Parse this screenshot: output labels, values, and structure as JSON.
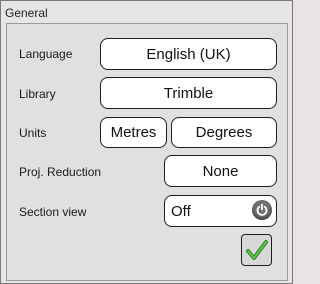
{
  "dialog": {
    "title": "General"
  },
  "settings": {
    "language": {
      "label": "Language",
      "value": "English (UK)"
    },
    "library": {
      "label": "Library",
      "value": "Trimble"
    },
    "units": {
      "label": "Units",
      "distance": "Metres",
      "angle": "Degrees"
    },
    "projection": {
      "label": "Proj. Reduction",
      "value": "None"
    },
    "section_view": {
      "label": "Section view",
      "value": "Off"
    }
  },
  "icons": {
    "power": "power-icon",
    "confirm": "checkmark-icon"
  },
  "colors": {
    "confirm_check": "#3aa02c",
    "power_button": "#707070"
  }
}
